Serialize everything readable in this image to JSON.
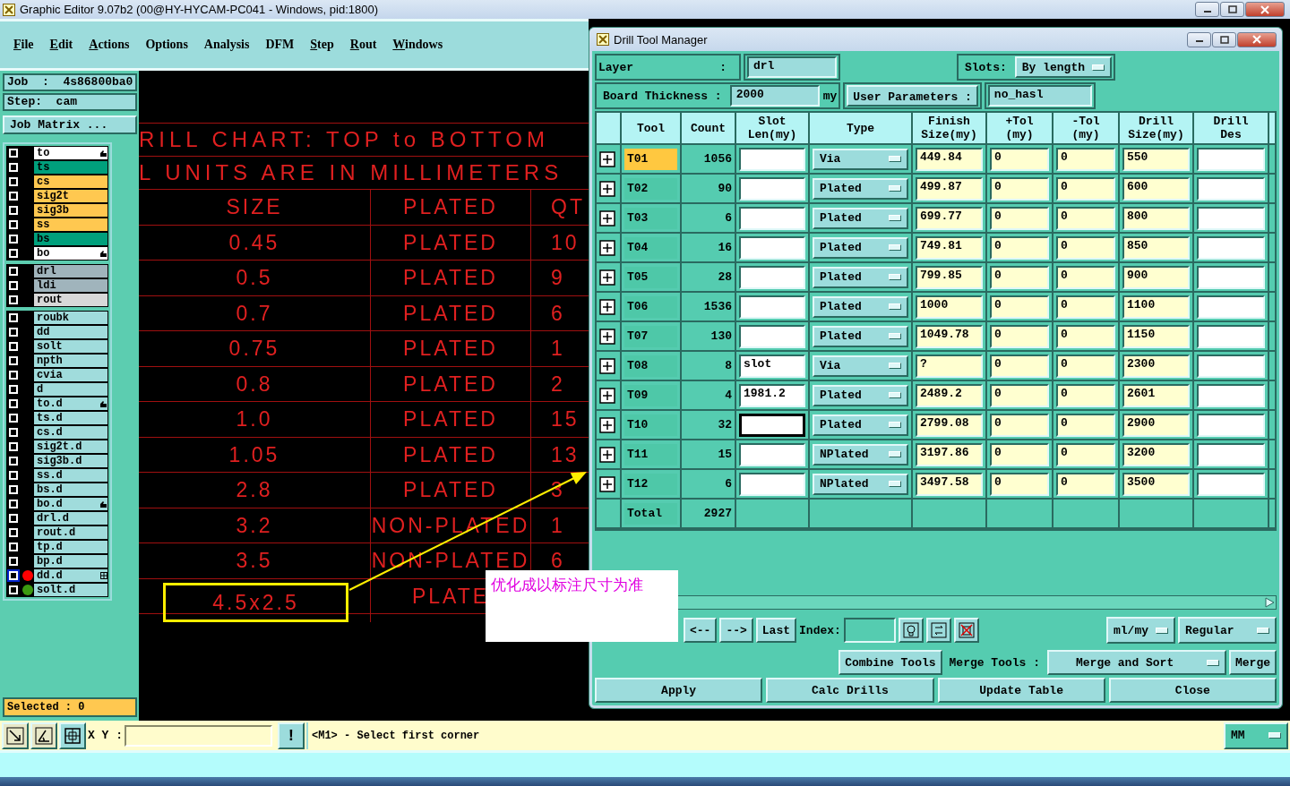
{
  "window": {
    "title": "Graphic Editor 9.07b2 (00@HY-HYCAM-PC041 - Windows, pid:1800)"
  },
  "menu": [
    {
      "label": "File",
      "mnemonic": true
    },
    {
      "label": "Edit",
      "mnemonic": true
    },
    {
      "label": "Actions",
      "mnemonic": true
    },
    {
      "label": "Options",
      "mnemonic": false
    },
    {
      "label": "Analysis",
      "mnemonic": false
    },
    {
      "label": "DFM",
      "mnemonic": false
    },
    {
      "label": "Step",
      "mnemonic": true
    },
    {
      "label": "Rout",
      "mnemonic": true
    },
    {
      "label": "Windows",
      "mnemonic": true
    }
  ],
  "job": "Job  :  4s86800ba0",
  "step": "Step:  cam",
  "job_matrix_button": "Job Matrix ...",
  "layer_groups": [
    {
      "layers": [
        {
          "name": "to",
          "color": "#ffffff",
          "marked": true,
          "active": false,
          "checked": false
        },
        {
          "name": "ts",
          "color": "#00a07c",
          "marked": false,
          "active": false,
          "checked": false
        },
        {
          "name": "cs",
          "color": "#ffc850",
          "marked": false,
          "active": false,
          "checked": false
        },
        {
          "name": "sig2t",
          "color": "#ffc850",
          "marked": false,
          "active": false,
          "checked": false
        },
        {
          "name": "sig3b",
          "color": "#ffc850",
          "marked": false,
          "active": false,
          "checked": false
        },
        {
          "name": "ss",
          "color": "#ffc850",
          "marked": false,
          "active": false,
          "checked": false
        },
        {
          "name": "bs",
          "color": "#00a07c",
          "marked": false,
          "active": false,
          "checked": false
        },
        {
          "name": "bo",
          "color": "#ffffff",
          "marked": true,
          "active": false,
          "checked": false
        }
      ]
    },
    {
      "layers": [
        {
          "name": "drl",
          "color": "#a0b4bc",
          "marked": false,
          "active": false,
          "checked": false
        },
        {
          "name": "ldi",
          "color": "#a0b4bc",
          "marked": false,
          "active": false,
          "checked": false
        },
        {
          "name": "rout",
          "color": "#d8d8d8",
          "marked": false,
          "active": false,
          "checked": false
        }
      ]
    },
    {
      "layers": [
        {
          "name": "roubk",
          "color": "#a0dcdc",
          "marked": false,
          "active": false,
          "checked": false
        },
        {
          "name": "dd",
          "color": "#a0dcdc",
          "marked": false,
          "active": false,
          "checked": false
        },
        {
          "name": "solt",
          "color": "#a0dcdc",
          "marked": false,
          "active": false,
          "checked": false
        },
        {
          "name": "npth",
          "color": "#a0dcdc",
          "marked": false,
          "active": false,
          "checked": false
        },
        {
          "name": "cvia",
          "color": "#a0dcdc",
          "marked": false,
          "active": false,
          "checked": false
        },
        {
          "name": "d",
          "color": "#a0dcdc",
          "marked": false,
          "active": false,
          "checked": false
        },
        {
          "name": "to.d",
          "color": "#a0dcdc",
          "marked": true,
          "active": false,
          "checked": false
        },
        {
          "name": "ts.d",
          "color": "#a0dcdc",
          "marked": false,
          "active": false,
          "checked": false
        },
        {
          "name": "cs.d",
          "color": "#a0dcdc",
          "marked": false,
          "active": false,
          "checked": false
        },
        {
          "name": "sig2t.d",
          "color": "#a0dcdc",
          "marked": false,
          "active": false,
          "checked": false
        },
        {
          "name": "sig3b.d",
          "color": "#a0dcdc",
          "marked": false,
          "active": false,
          "checked": false
        },
        {
          "name": "ss.d",
          "color": "#a0dcdc",
          "marked": false,
          "active": false,
          "checked": false
        },
        {
          "name": "bs.d",
          "color": "#a0dcdc",
          "marked": false,
          "active": false,
          "checked": false
        },
        {
          "name": "bo.d",
          "color": "#a0dcdc",
          "marked": true,
          "active": false,
          "checked": false
        },
        {
          "name": "drl.d",
          "color": "#a0dcdc",
          "marked": false,
          "active": false,
          "checked": false
        },
        {
          "name": "rout.d",
          "color": "#a0dcdc",
          "marked": false,
          "active": false,
          "checked": false
        },
        {
          "name": "tp.d",
          "color": "#a0dcdc",
          "marked": false,
          "active": false,
          "checked": false
        },
        {
          "name": "bp.d",
          "color": "#a0dcdc",
          "marked": false,
          "active": false,
          "checked": false
        },
        {
          "name": "dd.d",
          "color": "#a0dcdc",
          "marked": false,
          "active": true,
          "checked": false,
          "status": {
            "color": "#ff0000"
          }
        },
        {
          "name": "solt.d",
          "color": "#a0dcdc",
          "marked": false,
          "active": false,
          "checked": false,
          "status": {
            "color": "#3c9a10"
          }
        }
      ]
    }
  ],
  "selected_count": "Selected : 0",
  "drill_chart": {
    "title_lines": [
      "RILL CHART: TOP to BOTTOM",
      "L UNITS ARE IN MILLIMETERS"
    ],
    "header": [
      "SIZE",
      "PLATED",
      "QT"
    ],
    "rows": [
      {
        "size": "0.45",
        "plating": "PLATED",
        "qty": "10",
        "highlighted": false
      },
      {
        "size": "0.5",
        "plating": "PLATED",
        "qty": "9",
        "highlighted": false
      },
      {
        "size": "0.7",
        "plating": "PLATED",
        "qty": "6",
        "highlighted": false
      },
      {
        "size": "0.75",
        "plating": "PLATED",
        "qty": "1",
        "highlighted": false
      },
      {
        "size": "0.8",
        "plating": "PLATED",
        "qty": "2",
        "highlighted": false
      },
      {
        "size": "1.0",
        "plating": "PLATED",
        "qty": "15",
        "highlighted": false
      },
      {
        "size": "1.05",
        "plating": "PLATED",
        "qty": "13",
        "highlighted": false
      },
      {
        "size": "2.8",
        "plating": "PLATED",
        "qty": "3",
        "highlighted": false
      },
      {
        "size": "3.2",
        "plating": "NON-PLATED",
        "qty": "1",
        "highlighted": false
      },
      {
        "size": "3.5",
        "plating": "NON-PLATED",
        "qty": "6",
        "highlighted": false
      },
      {
        "size": "4.5x2.5",
        "plating": "PLATE",
        "highlighted": true
      }
    ],
    "note": "优化成以标注尺寸为准"
  },
  "dialog": {
    "title": "Drill Tool Manager",
    "layer_label": "Layer",
    "layer_colon": ":",
    "layer_value": "drl",
    "slots_label": "Slots:",
    "slots_value": "By length",
    "thickness_label": "Board Thickness :",
    "thickness_value": "2000",
    "thickness_unit": "my",
    "user_params_label": "User Parameters :",
    "user_params_value": "no_hasl",
    "columns": [
      "Tool",
      "Count",
      "Slot\nLen(my)",
      "Type",
      "Finish\nSize(my)",
      "+Tol\n(my)",
      "-Tol\n(my)",
      "Drill\nSize(my)",
      "Drill\nDes"
    ],
    "rows": [
      {
        "tool": "T01",
        "selected": true,
        "count": "1056",
        "slot_len": "",
        "focused": false,
        "type": "Via",
        "finish": "449.84",
        "plus_tol": "0",
        "minus_tol": "0",
        "drill_size": "550"
      },
      {
        "tool": "T02",
        "selected": false,
        "count": "90",
        "slot_len": "",
        "focused": false,
        "type": "Plated",
        "finish": "499.87",
        "plus_tol": "0",
        "minus_tol": "0",
        "drill_size": "600"
      },
      {
        "tool": "T03",
        "selected": false,
        "count": "6",
        "slot_len": "",
        "focused": false,
        "type": "Plated",
        "finish": "699.77",
        "plus_tol": "0",
        "minus_tol": "0",
        "drill_size": "800"
      },
      {
        "tool": "T04",
        "selected": false,
        "count": "16",
        "slot_len": "",
        "focused": false,
        "type": "Plated",
        "finish": "749.81",
        "plus_tol": "0",
        "minus_tol": "0",
        "drill_size": "850"
      },
      {
        "tool": "T05",
        "selected": false,
        "count": "28",
        "slot_len": "",
        "focused": false,
        "type": "Plated",
        "finish": "799.85",
        "plus_tol": "0",
        "minus_tol": "0",
        "drill_size": "900"
      },
      {
        "tool": "T06",
        "selected": false,
        "count": "1536",
        "slot_len": "",
        "focused": false,
        "type": "Plated",
        "finish": "1000",
        "plus_tol": "0",
        "minus_tol": "0",
        "drill_size": "1100"
      },
      {
        "tool": "T07",
        "selected": false,
        "count": "130",
        "slot_len": "",
        "focused": false,
        "type": "Plated",
        "finish": "1049.78",
        "plus_tol": "0",
        "minus_tol": "0",
        "drill_size": "1150"
      },
      {
        "tool": "T08",
        "selected": false,
        "count": "8",
        "slot_len": "slot",
        "focused": false,
        "type": "Via",
        "finish": "?",
        "plus_tol": "0",
        "minus_tol": "0",
        "drill_size": "2300"
      },
      {
        "tool": "T09",
        "selected": false,
        "count": "4",
        "slot_len": "1981.2",
        "focused": false,
        "type": "Plated",
        "finish": "2489.2",
        "plus_tol": "0",
        "minus_tol": "0",
        "drill_size": "2601"
      },
      {
        "tool": "T10",
        "selected": false,
        "count": "32",
        "slot_len": "",
        "focused": true,
        "type": "Plated",
        "finish": "2799.08",
        "plus_tol": "0",
        "minus_tol": "0",
        "drill_size": "2900"
      },
      {
        "tool": "T11",
        "selected": false,
        "count": "15",
        "slot_len": "",
        "focused": false,
        "type": "NPlated",
        "finish": "3197.86",
        "plus_tol": "0",
        "minus_tol": "0",
        "drill_size": "3200"
      },
      {
        "tool": "T12",
        "selected": false,
        "count": "6",
        "slot_len": "",
        "focused": false,
        "type": "NPlated",
        "finish": "3497.58",
        "plus_tol": "0",
        "minus_tol": "0",
        "drill_size": "3500"
      }
    ],
    "total_label": "Total",
    "total_count": "2927",
    "nav_buttons": [
      "<--",
      "-->",
      "Last"
    ],
    "index_label": "Index:",
    "units_value": "ml/my",
    "mode_value": "Regular",
    "combine_button": "Combine Tools",
    "merge_label": "Merge Tools :",
    "merge_value": "Merge and Sort",
    "merge_button": "Merge",
    "actions": [
      "Apply",
      "Calc Drills",
      "Update Table",
      "Close"
    ]
  },
  "toolbar": {
    "xy_label": "X Y :",
    "alert_button": "!",
    "status": "<M1> - Select first corner",
    "units": "MM"
  }
}
